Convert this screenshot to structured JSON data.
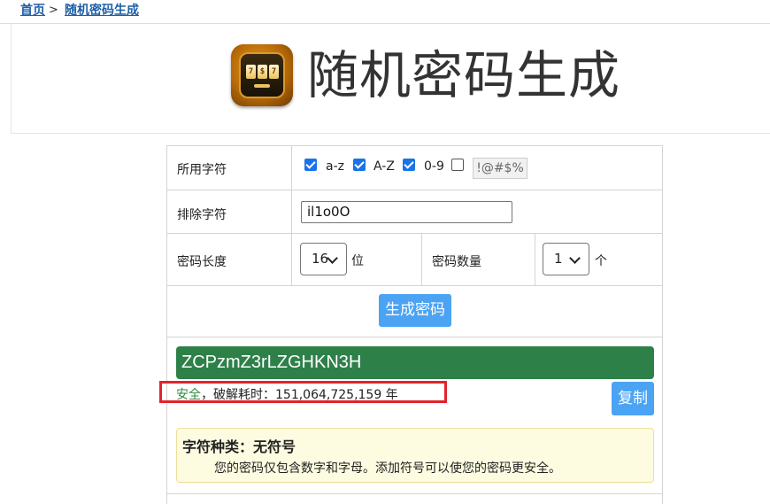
{
  "breadcrumb": {
    "home": "首页",
    "separator": ">",
    "current": "随机密码生成"
  },
  "header": {
    "title": "随机密码生成",
    "logo_icon": "slot-machine-icon"
  },
  "form": {
    "charset": {
      "label": "所用字符",
      "options": [
        {
          "label": "a-z",
          "checked": true
        },
        {
          "label": "A-Z",
          "checked": true
        },
        {
          "label": "0-9",
          "checked": true
        },
        {
          "label": "!@#$%",
          "checked": false
        }
      ]
    },
    "exclude": {
      "label": "排除字符",
      "checked": true,
      "value": "il1o0O"
    },
    "length": {
      "label": "密码长度",
      "value": "16",
      "unit": "位"
    },
    "count": {
      "label": "密码数量",
      "value": "1",
      "unit": "个"
    },
    "generate_label": "生成密码"
  },
  "result": {
    "password": "ZCPzmZ3rLZGHKN3H",
    "strength_word": "安全",
    "crack_time_text": "，破解耗时：151,064,725,159 年",
    "copy_label": "复制"
  },
  "tip": {
    "title": "字符种类：无符号",
    "body": "您的密码仅包含数字和字母。添加符号可以使您的密码更安全。"
  },
  "colors": {
    "accent": "#4ba3f3",
    "password_bg": "#2e8049",
    "safe_text": "#2e8b3e",
    "highlight_outline": "#e0242b",
    "tip_bg": "#fdfbe0"
  }
}
